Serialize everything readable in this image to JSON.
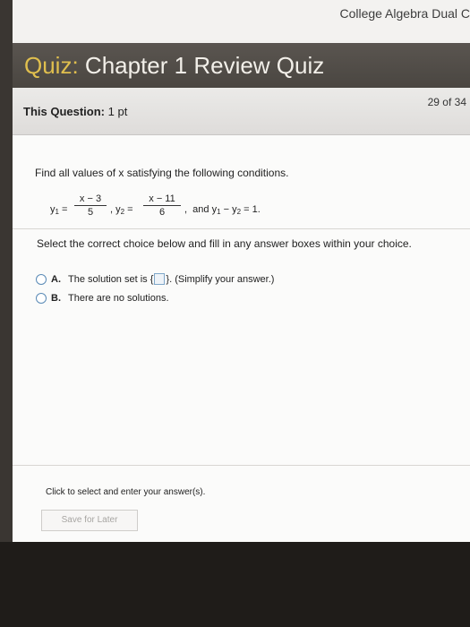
{
  "topbar": {
    "course": "College Algebra Dual C"
  },
  "quiz": {
    "prefix": "Quiz:",
    "title": "Chapter 1 Review Quiz"
  },
  "question_bar": {
    "label": "This Question:",
    "points": "1 pt",
    "counter": "29 of 34"
  },
  "question": {
    "prompt": "Find all values of x satisfying the following conditions.",
    "y1_num": "x − 3",
    "y1_den": "5",
    "y2_num": "x − 11",
    "y2_den": "6",
    "condition_text": "and y",
    "condition_rest": "= 1."
  },
  "instruction": "Select the correct choice below and fill in any answer boxes within your choice.",
  "choices": [
    {
      "letter": "A.",
      "text_before": "The solution set is",
      "text_after": "(Simplify your answer.)"
    },
    {
      "letter": "B.",
      "text": "There are no solutions."
    }
  ],
  "hint": "Click to select and enter your answer(s).",
  "save_button": "Save for Later",
  "colors": {
    "title_accent": "#e0bf4e",
    "radio_border": "#5a8ab6"
  }
}
